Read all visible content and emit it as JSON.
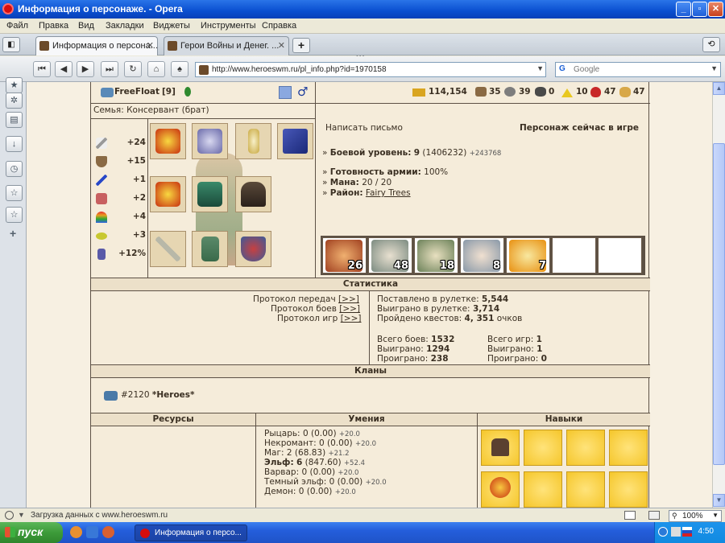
{
  "window": {
    "title": "Информация о персонаже. - Opera",
    "min": "_",
    "max": "▫",
    "close": "✕"
  },
  "menu": [
    "Файл",
    "Правка",
    "Вид",
    "Закладки",
    "Виджеты",
    "Инструменты",
    "Справка"
  ],
  "tabs": [
    {
      "label": "Информация о персона...",
      "active": true
    },
    {
      "label": "Герои Войны и Денег. ...",
      "active": false
    }
  ],
  "address": {
    "url": "http://www.heroeswm.ru/pl_info.php?id=1970158"
  },
  "search": {
    "placeholder": "Google"
  },
  "header": {
    "name": "FreeFloat",
    "level": "[9]",
    "family": "Семья: Консервант (брат)"
  },
  "resources": [
    {
      "icon": "gold-icon",
      "value": "114,154",
      "color": "#d9a520"
    },
    {
      "icon": "wood-icon",
      "value": "35",
      "color": "#8a6a44"
    },
    {
      "icon": "ore-icon",
      "value": "39",
      "color": "#7d7d7d"
    },
    {
      "icon": "mercury-icon",
      "value": "0",
      "color": "#4a4a4a"
    },
    {
      "icon": "sulfur-icon",
      "value": "10",
      "color": "#e8c820"
    },
    {
      "icon": "crystal-icon",
      "value": "47",
      "color": "#c82828"
    },
    {
      "icon": "gems-icon",
      "value": "47",
      "color": "#d8a848"
    }
  ],
  "stats": [
    {
      "icon": "attack-icon",
      "value": "+24",
      "color": "#9a9a9a"
    },
    {
      "icon": "defense-icon",
      "value": "+15",
      "color": "#8a6a44"
    },
    {
      "icon": "spellpower-icon",
      "value": "+1",
      "color": "#2848c8"
    },
    {
      "icon": "knowledge-icon",
      "value": "+2",
      "color": "#c86060"
    },
    {
      "icon": "luck-icon",
      "value": "+4",
      "color": "#e89a20"
    },
    {
      "icon": "morale-icon",
      "value": "+3",
      "color": "#c8c830"
    },
    {
      "icon": "initiative-icon",
      "value": "+12%",
      "color": "#5a5aa8"
    }
  ],
  "info": {
    "write_letter": "Написать письмо",
    "online_status": "Персонаж сейчас в игре",
    "combat_level_label": "Боевой уровень:",
    "combat_level": "9",
    "combat_exp": "(1406232)",
    "combat_exp_gain": "+243768",
    "army_ready_label": "Готовность армии:",
    "army_ready": "100%",
    "mana_label": "Мана:",
    "mana": "20 / 20",
    "district_label": "Район:",
    "district": "Fairy Trees"
  },
  "army": [
    {
      "count": "26",
      "color": "#c06030"
    },
    {
      "count": "48",
      "color": "#9aa6a0"
    },
    {
      "count": "18",
      "color": "#8ea078"
    },
    {
      "count": "8",
      "color": "#a8b8c8"
    },
    {
      "count": "7",
      "color": "#e8b020"
    },
    {
      "count": "",
      "color": "#ffffff"
    },
    {
      "count": "",
      "color": "#ffffff"
    }
  ],
  "statistics": {
    "title": "Статистика",
    "protocols": [
      {
        "label": "Протокол передач",
        "link": "[>>]"
      },
      {
        "label": "Протокол боев",
        "link": "[>>]"
      },
      {
        "label": "Протокол игр",
        "link": "[>>]"
      }
    ],
    "roulette_bet_label": "Поставлено в рулетке:",
    "roulette_bet": "5,544",
    "roulette_won_label": "Выиграно в рулетке:",
    "roulette_won": "3,714",
    "quests_label": "Пройдено квестов:",
    "quests": "4, 351",
    "quests_unit": "очков",
    "battles_total_label": "Всего боев:",
    "battles_total": "1532",
    "battles_won_label": "Выиграно:",
    "battles_won": "1294",
    "battles_lost_label": "Проиграно:",
    "battles_lost": "238",
    "games_total_label": "Всего игр:",
    "games_total": "1",
    "games_won_label": "Выиграно:",
    "games_won": "1",
    "games_lost_label": "Проиграно:",
    "games_lost": "0"
  },
  "clans": {
    "title": "Кланы",
    "clan_id": "#2120",
    "clan_name": "*Heroes*"
  },
  "sections": {
    "resources": "Ресурсы",
    "abilities": "Умения",
    "skills": "Навыки"
  },
  "abilities": [
    {
      "name": "Рыцарь:",
      "value": "0 (0.00)",
      "gain": "+20.0",
      "bold": false
    },
    {
      "name": "Некромант:",
      "value": "0 (0.00)",
      "gain": "+20.0",
      "bold": false
    },
    {
      "name": "Маг:",
      "value": "2 (68.83)",
      "gain": "+21.2",
      "bold": false
    },
    {
      "name": "Эльф:",
      "value": "6",
      "extra": "(847.60)",
      "gain": "+52.4",
      "bold": true
    },
    {
      "name": "Варвар:",
      "value": "0 (0.00)",
      "gain": "+20.0",
      "bold": false
    },
    {
      "name": "Темный эльф:",
      "value": "0 (0.00)",
      "gain": "+20.0",
      "bold": false
    },
    {
      "name": "Демон:",
      "value": "0 (0.00)",
      "gain": "+20.0",
      "bold": false
    }
  ],
  "status": {
    "text": "Загрузка данных с www.heroeswm.ru",
    "zoom": "100%"
  },
  "taskbar": {
    "start": "пуск",
    "task": "Информация о персо...",
    "clock": "4:50"
  }
}
